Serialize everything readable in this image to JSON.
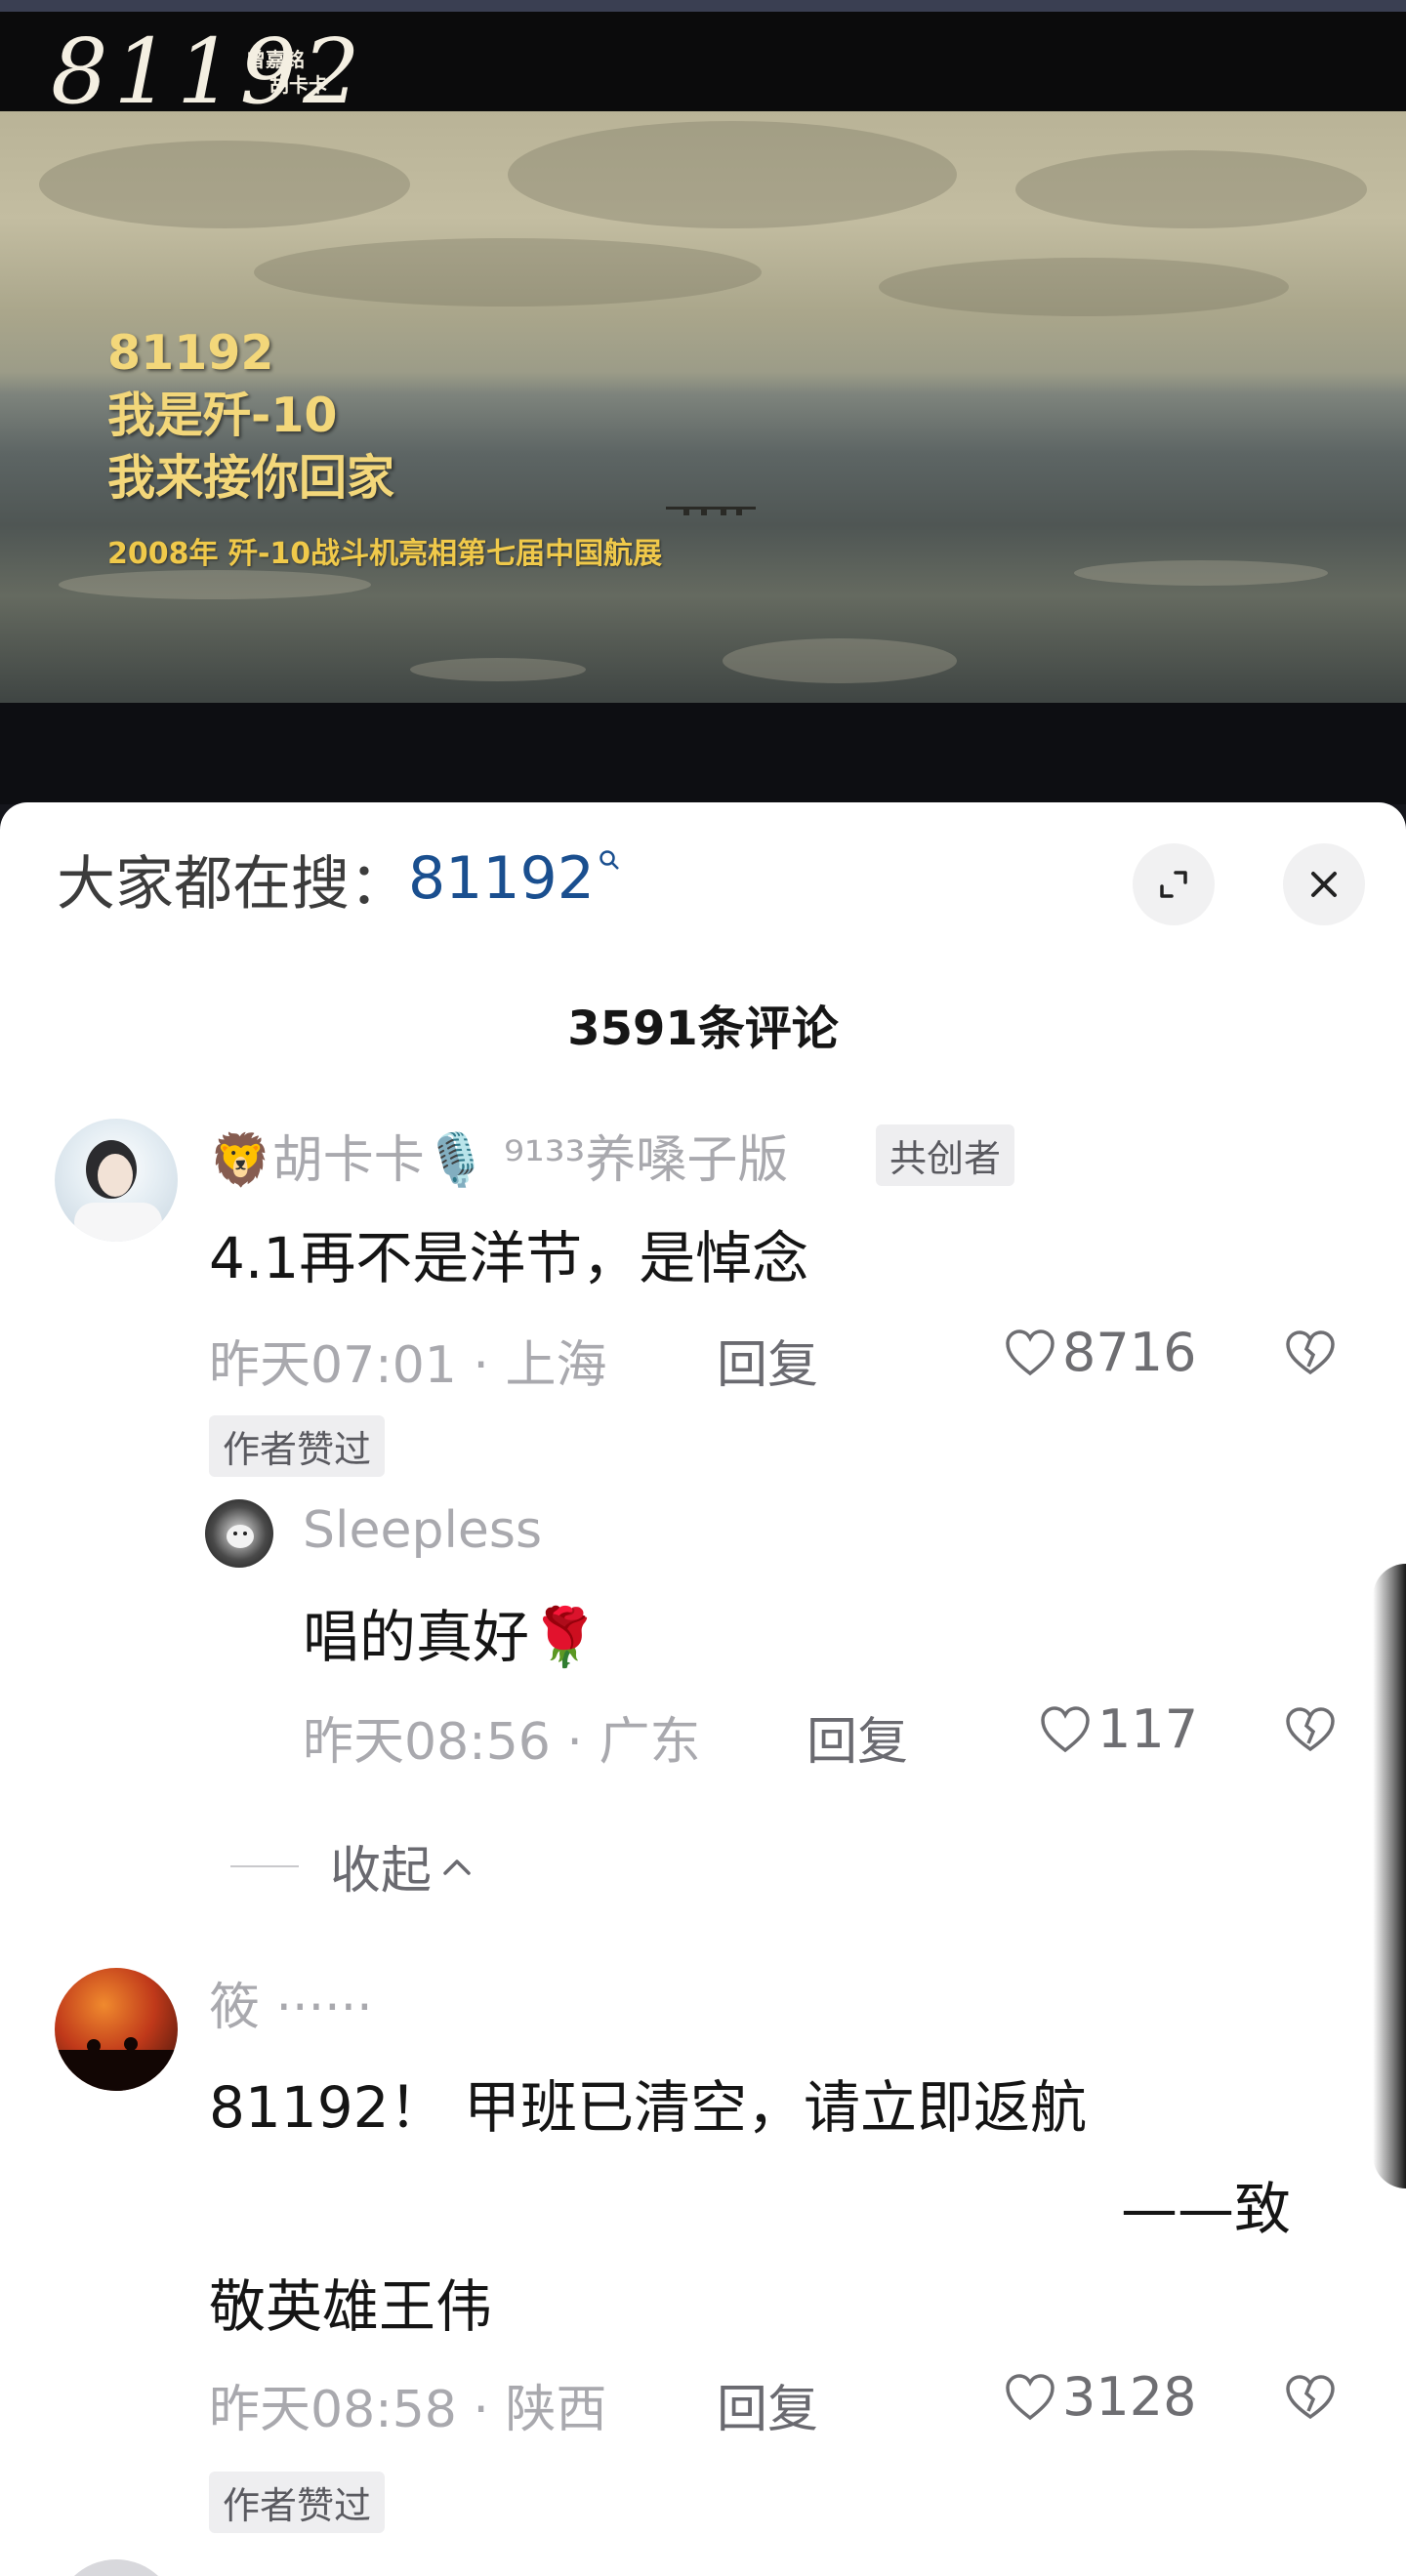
{
  "video": {
    "logo": "81192",
    "credit_1": "曾嘉铭",
    "credit_2": "胡卡卡",
    "line_1": "81192",
    "line_2": "我是歼-10",
    "line_3": "我来接你回家",
    "subtitle": "2008年 歼-10战斗机亮相第七届中国航展"
  },
  "search": {
    "prefix": "大家都在搜：",
    "term": "81192",
    "suffix_icon": "search-icon"
  },
  "comments_count": "3591条评论",
  "comments": [
    {
      "username": "🦁胡卡卡🎙️ ⁹¹³³养嗓子版",
      "badge": "共创者",
      "text": "4.1再不是洋节，是悼念",
      "time_location": "昨天07:01 · 上海",
      "reply": "回复",
      "likes": "8716",
      "author_liked": "作者赞过",
      "replies": [
        {
          "username": "Sleepless",
          "text": "唱的真好🌹",
          "time_location": "昨天08:56 · 广东",
          "reply": "回复",
          "likes": "117"
        }
      ],
      "collapse": "收起"
    },
    {
      "username": "筱 ······",
      "text_line_1": "81192！ 甲班已清空，请立即返航",
      "text_line_2": "——致",
      "text_line_3": "敬英雄王伟",
      "time_location": "昨天08:58 · 陕西",
      "reply": "回复",
      "likes": "3128",
      "author_liked": "作者赞过"
    }
  ],
  "colors": {
    "search_term": "#1a4f8f",
    "meta_gray": "#a9a9ae",
    "video_text": "#f3d77a"
  }
}
